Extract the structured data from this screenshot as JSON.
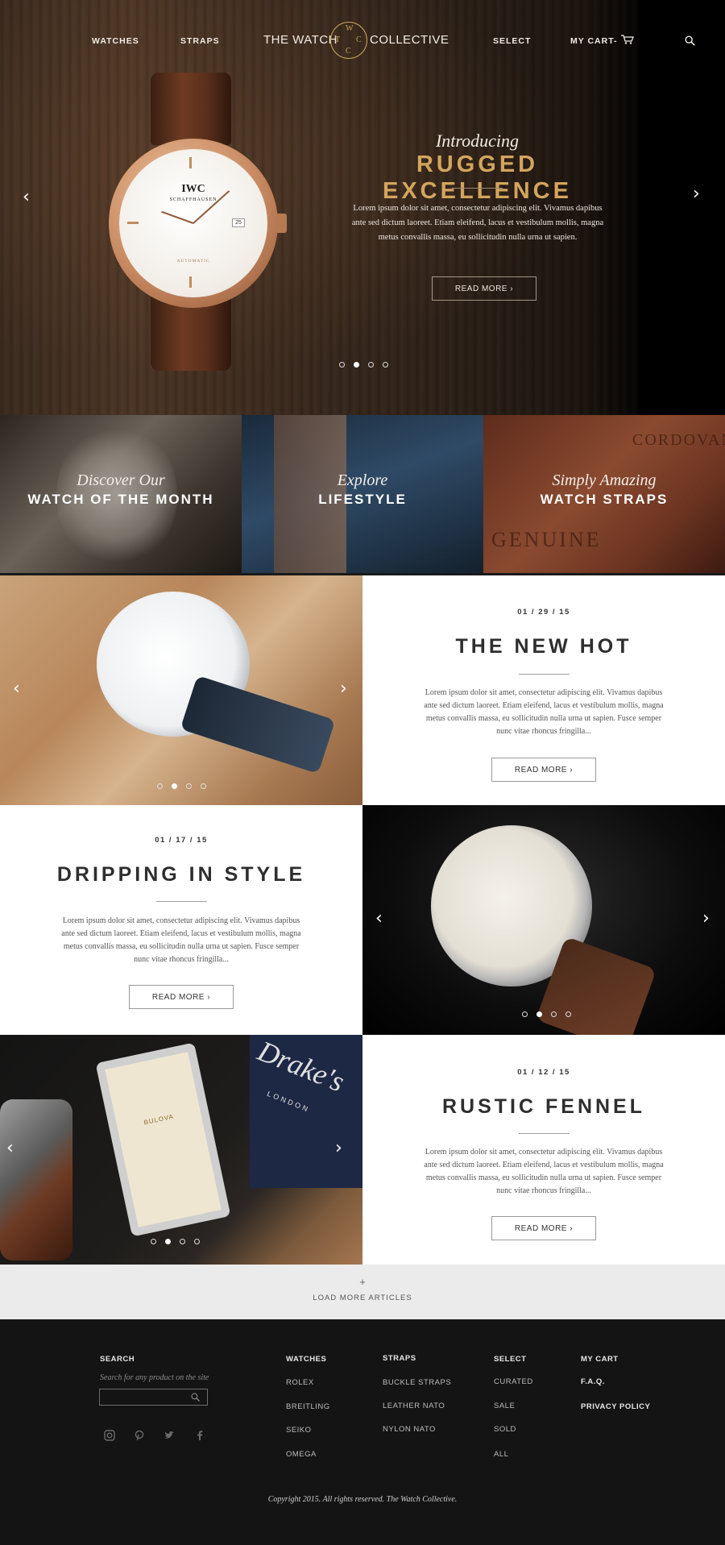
{
  "nav": {
    "watches": "WATCHES",
    "straps": "STRAPS",
    "logo_left": "THE WATCH",
    "logo_right": "COLLECTIVE",
    "logo_letters": [
      "W",
      "T",
      "C",
      "C"
    ],
    "select": "SELECT",
    "cart": "MY CART",
    "cart_sep": "-",
    "icons": {
      "cart": "cart-icon",
      "search": "search-icon"
    }
  },
  "hero": {
    "subtitle": "Introducing",
    "title": "RUGGED EXCELLENCE",
    "body": "Lorem ipsum dolor sit amet, consectetur adipiscing elit. Vivamus dapibus ante sed dictum laoreet. Etiam eleifend, lacus et vestibulum mollis, magna metus convallis massa, eu sollicitudin nulla urna ut sapien.",
    "button": "READ MORE ›",
    "watch_brand": "IWC",
    "watch_sub": "SCHAFFHAUSEN",
    "watch_auto": "AUTOMATIC",
    "watch_date": "25",
    "slides": 4,
    "active_slide": 2,
    "prev_arrow": "‹",
    "next_arrow": "›"
  },
  "tiles": [
    {
      "subtitle": "Discover Our",
      "title": "WATCH OF THE MONTH"
    },
    {
      "subtitle": "Explore",
      "title": "LIFESTYLE"
    },
    {
      "subtitle": "Simply Amazing",
      "title": "WATCH STRAPS"
    }
  ],
  "articles": [
    {
      "date": "01 / 29 / 15",
      "title": "THE NEW HOT",
      "body": "Lorem ipsum dolor sit amet, consectetur adipiscing elit. Vivamus dapibus ante sed dictum laoreet. Etiam eleifend, lacus et vestibulum mollis, magna metus convallis massa, eu sollicitudin nulla urna ut sapien. Fusce semper nunc vitae rhoncus fringilla...",
      "button": "READ MORE ›",
      "slides": 4,
      "active_slide": 2
    },
    {
      "date": "01 / 17 / 15",
      "title": "DRIPPING IN STYLE",
      "body": "Lorem ipsum dolor sit amet, consectetur adipiscing elit. Vivamus dapibus ante sed dictum laoreet. Etiam eleifend, lacus et vestibulum mollis, magna metus convallis massa, eu sollicitudin nulla urna ut sapien. Fusce semper nunc vitae rhoncus fringilla...",
      "button": "READ MORE ›",
      "slides": 4,
      "active_slide": 2
    },
    {
      "date": "01 / 12 / 15",
      "title": "RUSTIC FENNEL",
      "body": "Lorem ipsum dolor sit amet, consectetur adipiscing elit. Vivamus dapibus ante sed dictum laoreet. Etiam eleifend, lacus et vestibulum mollis, magna metus convallis massa, eu sollicitudin nulla urna ut sapien. Fusce semper nunc vitae rhoncus fringilla...",
      "button": "READ MORE ›",
      "slides": 4,
      "active_slide": 2
    }
  ],
  "photo_labels": {
    "bulova": "BULOVA",
    "drakes": "Drake's",
    "london": "LONDON",
    "cordovan": "CORDOVAN",
    "genuine": "GENUINE"
  },
  "load_more": {
    "plus": "+",
    "label": "LOAD MORE ARTICLES"
  },
  "footer": {
    "search_title": "SEARCH",
    "search_hint": "Search for any product on the site",
    "search_value": "",
    "social_icons": [
      "instagram-icon",
      "pinterest-icon",
      "twitter-icon",
      "facebook-icon"
    ],
    "columns": [
      {
        "title": "WATCHES",
        "links": [
          "ROLEX",
          "BREITLING",
          "SEIKO",
          "OMEGA"
        ]
      },
      {
        "title": "STRAPS",
        "links": [
          "BUCKLE STRAPS",
          "LEATHER NATO",
          "NYLON NATO"
        ]
      },
      {
        "title": "SELECT",
        "links": [
          "CURATED",
          "SALE",
          "SOLD",
          "ALL"
        ]
      }
    ],
    "extra_links": [
      "MY CART",
      "F.A.Q.",
      "PRIVACY POLICY"
    ],
    "copyright": "Copyright 2015. All rights reserved. The Watch Collective."
  },
  "colors": {
    "accent_gold": "#d3a55d",
    "footer_bg": "#141414",
    "load_more_bg": "#ebebeb"
  }
}
